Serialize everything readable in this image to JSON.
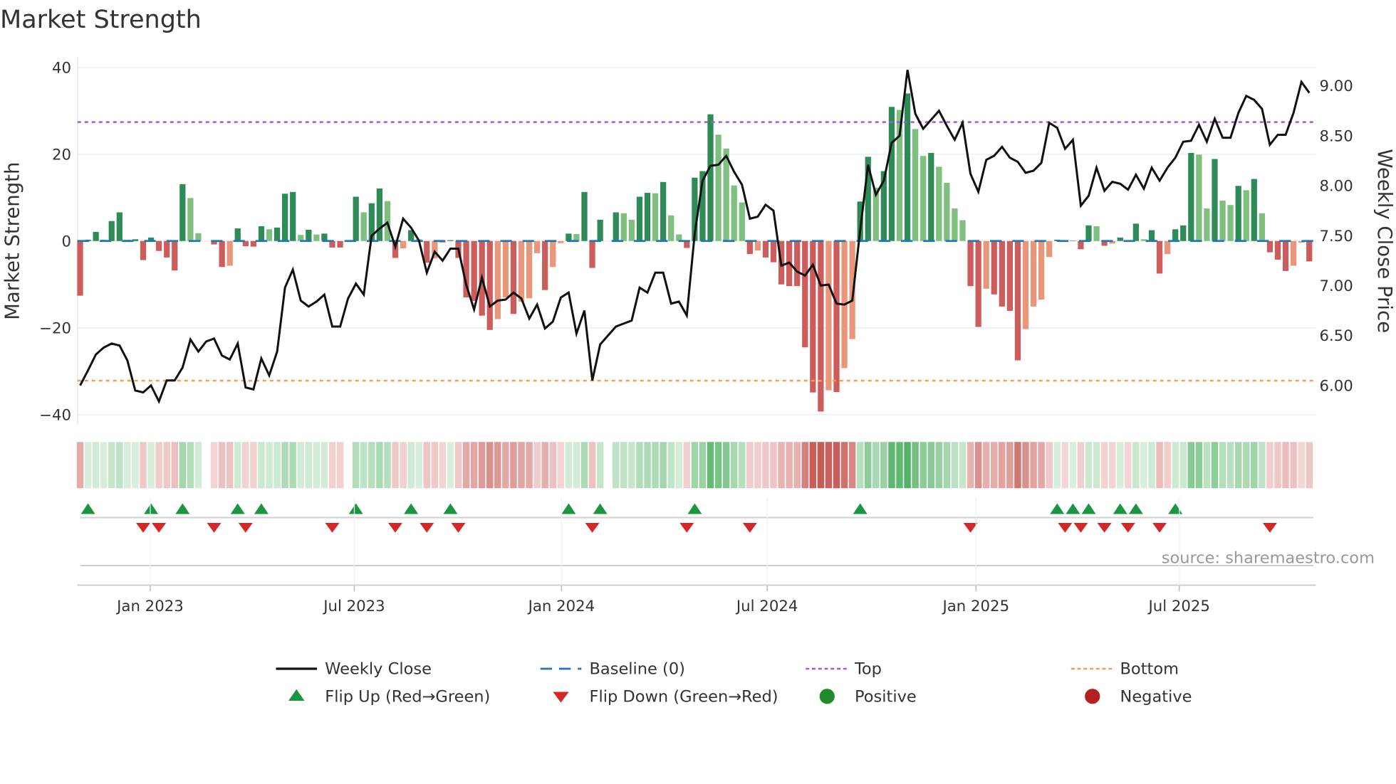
{
  "chart_data": {
    "type": "bar",
    "title": "Market Strength",
    "ylabel": "Market Strength",
    "y2label": "Weekly Close Price",
    "ylim": [
      -42,
      42
    ],
    "y2lim": [
      5.72,
      9.24
    ],
    "yticks": [
      "40",
      "20",
      "0",
      "−20",
      "−40"
    ],
    "ytick_values": [
      40,
      20,
      0,
      -20,
      -40
    ],
    "y2ticks": [
      "9.00",
      "8.50",
      "8.00",
      "7.50",
      "7.00",
      "6.50",
      "6.00"
    ],
    "y2tick_values": [
      9.0,
      8.5,
      8.0,
      7.5,
      7.0,
      6.5,
      6.0
    ],
    "xticks": [
      {
        "label": "Jan 2023",
        "week": 8.9
      },
      {
        "label": "Jul 2023",
        "week": 34.8
      },
      {
        "label": "Jan 2024",
        "week": 61.1
      },
      {
        "label": "Jul 2024",
        "week": 87.2
      },
      {
        "label": "Jan 2025",
        "week": 113.7
      },
      {
        "label": "Jul 2025",
        "week": 139.5
      }
    ],
    "x_unit": "week index (weekly bars)",
    "top_level": 27.4,
    "bottom_level": -32.2,
    "baseline": 0,
    "grid": true,
    "series": [
      {
        "name": "Market Strength",
        "type": "bar",
        "axis": "left",
        "values": [
          -12.6,
          0.3,
          2.1,
          0.3,
          4.6,
          6.6,
          0.3,
          0.4,
          -4.4,
          0.8,
          -2.3,
          -3.8,
          -6.8,
          13.1,
          9.9,
          1.8,
          0,
          -0.8,
          -6,
          -5.7,
          2.9,
          -1.2,
          -1.3,
          3.4,
          2.7,
          3.1,
          10.9,
          11.3,
          1.4,
          2.6,
          1.5,
          1.7,
          -1.5,
          -1.5,
          0,
          10.2,
          6.6,
          8.7,
          12.1,
          9.2,
          -3.9,
          -1.7,
          2.5,
          0.4,
          -5,
          -4,
          -0.4,
          0.2,
          -3.9,
          -13,
          -13.8,
          -17.2,
          -20.5,
          -18,
          -13,
          -16.8,
          -14,
          -13.2,
          -2.8,
          -11.3,
          -6,
          -0.5,
          1.7,
          1.6,
          11.3,
          -6.2,
          4.9,
          0,
          6.6,
          6.4,
          4.9,
          10.2,
          11.1,
          11.0,
          13.6,
          5.9,
          1.5,
          -1.6,
          14.6,
          16.1,
          29.2,
          24.5,
          21.3,
          12.8,
          8.9,
          -3.0,
          -2.2,
          -3.8,
          -4.9,
          -10,
          -10.4,
          -10.4,
          -24.5,
          -34.9,
          -39.3,
          -34.4,
          -34.8,
          -29.3,
          -22.6,
          9.1,
          19.4,
          12.3,
          16.1,
          30.9,
          30.2,
          34,
          25.8,
          19.6,
          20.3,
          17.1,
          13.4,
          7.5,
          4.8,
          -10.4,
          -19.8,
          -11.0,
          -12.3,
          -15.1,
          -16.1,
          -27.5,
          -20.3,
          -15.1,
          -13.5,
          -3.7,
          0.3,
          -0.1,
          0.1,
          -1.9,
          3.6,
          3.4,
          -1.1,
          -0.6,
          0.8,
          -0.1,
          4.0,
          0.4,
          2.5,
          -7.5,
          -3.0,
          2.7,
          3.6,
          20.3,
          19.9,
          7.5,
          18.9,
          9.3,
          8.3,
          12.7,
          11.7,
          14.3,
          6.4,
          -2.6,
          -4.3,
          -6.9,
          -5.7,
          -0.4,
          -4.7
        ]
      },
      {
        "name": "Weekly Close",
        "type": "line",
        "axis": "right",
        "values": [
          6.0,
          6.15,
          6.31,
          6.38,
          6.42,
          6.4,
          6.25,
          5.95,
          5.93,
          6.0,
          5.84,
          6.05,
          6.05,
          6.18,
          6.46,
          6.34,
          6.44,
          6.47,
          6.3,
          6.26,
          6.42,
          5.98,
          5.96,
          6.27,
          6.1,
          6.34,
          6.98,
          7.16,
          6.85,
          6.79,
          6.84,
          6.91,
          6.59,
          6.59,
          6.87,
          7.02,
          6.91,
          7.5,
          7.57,
          7.63,
          7.39,
          7.67,
          7.58,
          7.45,
          7.13,
          7.34,
          7.25,
          7.37,
          7.37,
          7.01,
          6.76,
          7.08,
          6.79,
          6.85,
          6.86,
          6.93,
          6.87,
          6.67,
          6.81,
          6.57,
          6.64,
          6.88,
          6.93,
          6.52,
          6.75,
          6.05,
          6.41,
          6.5,
          6.59,
          6.62,
          6.65,
          6.98,
          6.93,
          7.13,
          7.13,
          6.82,
          6.84,
          6.7,
          7.52,
          8.05,
          8.2,
          8.21,
          8.3,
          8.14,
          8.01,
          7.67,
          7.69,
          7.81,
          7.75,
          7.2,
          7.23,
          7.14,
          7.1,
          7.21,
          7.0,
          7.01,
          6.82,
          6.81,
          6.85,
          7.55,
          8.21,
          7.91,
          8.05,
          8.43,
          8.5,
          9.16,
          8.72,
          8.57,
          8.66,
          8.75,
          8.6,
          8.46,
          8.63,
          8.12,
          7.94,
          8.26,
          8.3,
          8.39,
          8.28,
          8.24,
          8.13,
          8.15,
          8.23,
          8.63,
          8.58,
          8.37,
          8.46,
          7.8,
          7.9,
          8.18,
          7.95,
          8.04,
          8.02,
          7.96,
          8.11,
          7.97,
          8.18,
          8.05,
          8.18,
          8.28,
          8.44,
          8.45,
          8.61,
          8.44,
          8.67,
          8.48,
          8.48,
          8.73,
          8.9,
          8.86,
          8.77,
          8.41,
          8.51,
          8.51,
          8.73,
          9.04,
          8.93
        ]
      }
    ],
    "flip_up_weeks": [
      1,
      9,
      13,
      20,
      23,
      35,
      42,
      47,
      62,
      66,
      78,
      99,
      124,
      126,
      128,
      132,
      134,
      139
    ],
    "flip_down_weeks": [
      8,
      10,
      17,
      21,
      32,
      40,
      44,
      48,
      65,
      77,
      85,
      113,
      125,
      127,
      130,
      133,
      137,
      151
    ],
    "legend": {
      "placement": "bottom",
      "items": [
        {
          "label": "Weekly Close",
          "symbol": "line",
          "color": "#111111"
        },
        {
          "label": "Baseline (0)",
          "symbol": "dashed",
          "color": "#1f77b4"
        },
        {
          "label": "Top",
          "symbol": "dotted",
          "color": "#9b5fd6"
        },
        {
          "label": "Bottom",
          "symbol": "dotted",
          "color": "#f0a050"
        },
        {
          "label": "Flip Up (Red→Green)",
          "symbol": "triangle-up",
          "color": "#1a9641"
        },
        {
          "label": "Flip Down (Green→Red)",
          "symbol": "triangle-down",
          "color": "#d62728"
        },
        {
          "label": "Positive",
          "symbol": "circle",
          "color": "#1f8b2c"
        },
        {
          "label": "Negative",
          "symbol": "circle",
          "color": "#b22222"
        }
      ]
    },
    "source": "source: sharemaestro.com"
  },
  "colors": {
    "pos_strong": "#2e8b57",
    "pos_weak": "#7fbf7f",
    "neg_strong": "#cd5c5c",
    "neg_weak": "#e9967a"
  }
}
